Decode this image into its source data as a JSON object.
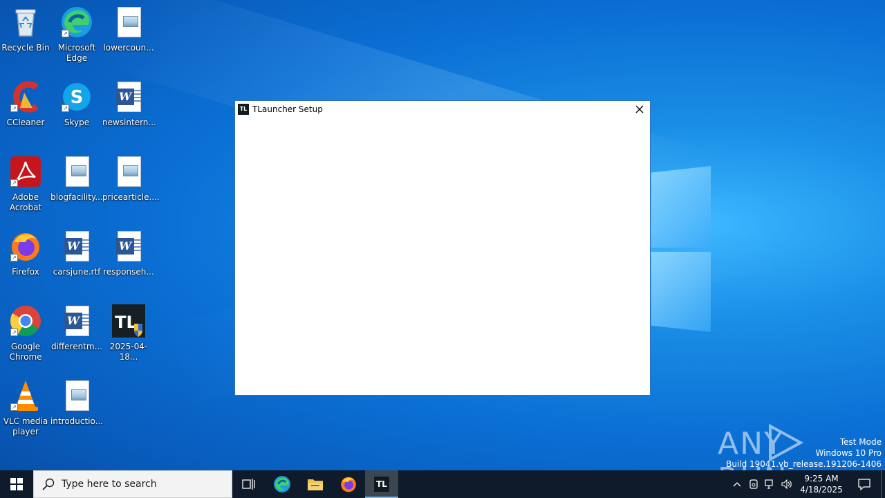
{
  "desktop": {
    "icons": [
      {
        "label": "Recycle Bin",
        "icon": "recycle-bin-icon"
      },
      {
        "label": "Microsoft Edge",
        "icon": "edge-icon"
      },
      {
        "label": "lowercoun...",
        "icon": "image-file-icon"
      },
      {
        "label": "CCleaner",
        "icon": "ccleaner-icon"
      },
      {
        "label": "Skype",
        "icon": "skype-icon"
      },
      {
        "label": "newsintern...",
        "icon": "word-doc-icon"
      },
      {
        "label": "Adobe Acrobat",
        "icon": "acrobat-icon"
      },
      {
        "label": "blogfacility...",
        "icon": "image-file-icon"
      },
      {
        "label": "pricearticle....",
        "icon": "image-file-icon"
      },
      {
        "label": "Firefox",
        "icon": "firefox-icon"
      },
      {
        "label": "carsjune.rtf",
        "icon": "word-doc-icon"
      },
      {
        "label": "responseh...",
        "icon": "word-doc-icon"
      },
      {
        "label": "Google Chrome",
        "icon": "chrome-icon"
      },
      {
        "label": "differentm...",
        "icon": "word-doc-icon"
      },
      {
        "label": "2025-04-18...",
        "icon": "tlauncher-installer-icon"
      },
      {
        "label": "VLC media player",
        "icon": "vlc-icon"
      },
      {
        "label": "introductio...",
        "icon": "image-file-icon"
      }
    ]
  },
  "window": {
    "app_icon_text": "TL",
    "title": "TLauncher Setup",
    "close_icon": "close-icon"
  },
  "watermark": {
    "brand": "ANY RUN",
    "mode": "Test Mode",
    "os": "Windows 10 Pro",
    "build": "Build 19041.vb_release.191206-1406"
  },
  "taskbar": {
    "search_placeholder": "Type here to search",
    "pinned": [
      {
        "name": "task-view-icon"
      },
      {
        "name": "edge-icon"
      },
      {
        "name": "file-explorer-icon"
      },
      {
        "name": "firefox-icon"
      },
      {
        "name": "tlauncher-icon",
        "text": "TL",
        "active": true
      }
    ],
    "time": "9:25 AM",
    "date": "4/18/2025"
  },
  "colors": {
    "taskbar_bg": "#0f1b2a",
    "window_border": "#2f6fb8",
    "accent": "#76b9ed"
  }
}
